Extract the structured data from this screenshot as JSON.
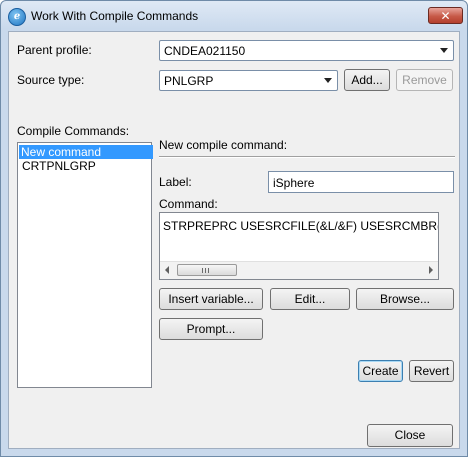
{
  "window": {
    "title": "Work With Compile Commands",
    "icon_letter": "ℯ",
    "close_glyph": "✕"
  },
  "parent_profile": {
    "label": "Parent profile:",
    "value": "CNDEA021150"
  },
  "source_type": {
    "label": "Source type:",
    "value": "PNLGRP",
    "add_label": "Add...",
    "remove_label": "Remove"
  },
  "compile_commands": {
    "label": "Compile Commands:",
    "items": [
      "New command",
      "CRTPNLGRP"
    ]
  },
  "editor": {
    "header": "New compile command:",
    "label_caption": "Label:",
    "label_value": "iSphere",
    "command_caption": "Command:",
    "command_value": "STRPREPRC USESRCFILE(&L/&F) USESRCMBR(&N)",
    "insert_variable_label": "Insert variable...",
    "edit_label": "Edit...",
    "browse_label": "Browse...",
    "prompt_label": "Prompt...",
    "create_label": "Create",
    "revert_label": "Revert"
  },
  "footer": {
    "close_label": "Close"
  }
}
